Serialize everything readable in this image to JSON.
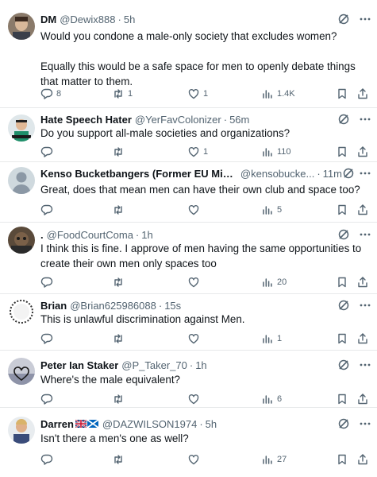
{
  "tweets": [
    {
      "name": "DM",
      "handle": "@Dewix888",
      "time": "5h",
      "paragraphs": [
        "Would you condone a male-only society that excludes women?",
        "Equally this would be a safe space for men to openly debate things that matter to them."
      ],
      "replies": "8",
      "reposts": "1",
      "likes": "1",
      "views": "1.4K"
    },
    {
      "name": "Hate Speech Hater",
      "handle": "@YerFavColonizer",
      "time": "56m",
      "paragraphs": [
        "Do you support all-male societies and organizations?"
      ],
      "replies": "",
      "reposts": "",
      "likes": "1",
      "views": "110"
    },
    {
      "name": "Kenso Bucketbangers (Former EU Minion)...",
      "handle": "@kensobucke...",
      "time": "11m",
      "paragraphs": [
        "Great, does that mean men can have their own club and space too?"
      ],
      "replies": "",
      "reposts": "",
      "likes": "",
      "views": "5"
    },
    {
      "name": ".",
      "handle": "@FoodCourtComa",
      "time": "1h",
      "paragraphs": [
        "I think this is fine.  I approve of men having the same opportunities to create their own men only spaces too"
      ],
      "replies": "",
      "reposts": "",
      "likes": "",
      "views": "20"
    },
    {
      "name": "Brian",
      "handle": "@Brian625986088",
      "time": "15s",
      "paragraphs": [
        "This is unlawful discrimination against Men."
      ],
      "replies": "",
      "reposts": "",
      "likes": "",
      "views": "1"
    },
    {
      "name": "Peter Ian Staker",
      "handle": "@P_Taker_70",
      "time": "1h",
      "paragraphs": [
        "Where's the male equivalent?"
      ],
      "replies": "",
      "reposts": "",
      "likes": "",
      "views": "6"
    },
    {
      "name": "Darren",
      "handle": "@DAZWILSON1974",
      "time": "5h",
      "paragraphs": [
        "Isn't there a men's one as well?"
      ],
      "replies": "",
      "reposts": "",
      "likes": "",
      "views": "27"
    }
  ],
  "separator": "·",
  "icons": {
    "reply": "reply-icon",
    "repost": "repost-icon",
    "like": "like-icon",
    "views": "views-icon",
    "bookmark": "bookmark-icon",
    "share": "share-icon",
    "grok": "grok-icon",
    "more": "more-icon",
    "flags": [
      "uk-flag-icon",
      "scotland-flag-icon"
    ]
  },
  "colors": {
    "text": "#0f1419",
    "secondary": "#536471",
    "divider": "#e7e9ea"
  }
}
